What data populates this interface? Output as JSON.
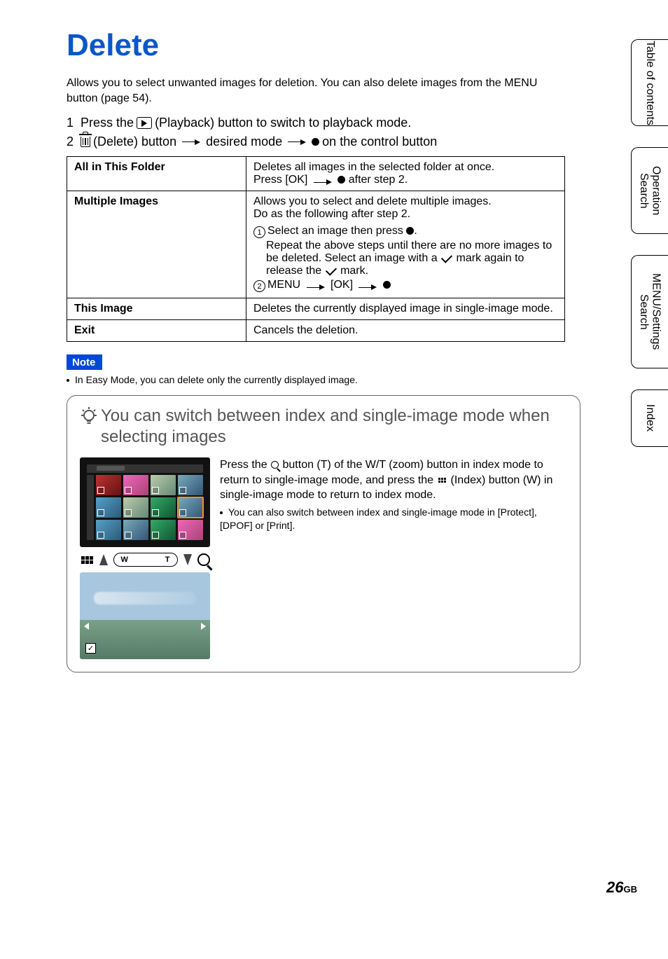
{
  "title": "Delete",
  "intro": "Allows you to select unwanted images for deletion. You can also delete images from the MENU button (page 54).",
  "step1": {
    "num": "1",
    "before": "Press the",
    "after": "(Playback) button to switch to playback mode."
  },
  "step2": {
    "num": "2",
    "a": "(Delete) button",
    "b": "desired mode",
    "c": "on the control button"
  },
  "table": {
    "r1": {
      "label": "All in This Folder",
      "line1": "Deletes all images in the selected folder at once.",
      "line2a": "Press [OK]",
      "line2b": "after step 2."
    },
    "r2": {
      "label": "Multiple Images",
      "line1": "Allows you to select and delete multiple images.",
      "line2": "Do as the following after step 2.",
      "s1a": "Select an image then press",
      "s1b": ".",
      "s1c": "Repeat the above steps until there are no more images to be deleted. Select an image with a",
      "s1d": "mark again to release the",
      "s1e": "mark.",
      "s2a": "MENU",
      "s2b": "[OK]"
    },
    "r3": {
      "label": "This Image",
      "desc": "Deletes the currently displayed image in single-image mode."
    },
    "r4": {
      "label": "Exit",
      "desc": "Cancels the deletion."
    }
  },
  "note": {
    "badge": "Note",
    "text": "In Easy Mode, you can delete only the currently displayed image."
  },
  "tip": {
    "title": "You can switch between index and single-image mode when selecting images",
    "body_a": "Press the",
    "body_b": "button (T) of the W/T (zoom) button in index mode to return to single-image mode, and press the",
    "body_c": "(Index) button (W) in single-image mode to return to index mode.",
    "sub": "You can also switch between index and single-image mode in [Protect], [DPOF] or [Print].",
    "zoom_w": "W",
    "zoom_t": "T"
  },
  "tabs": {
    "t1": "Table of contents",
    "t2": "Operation Search",
    "t3": "MENU/Settings Search",
    "t4": "Index"
  },
  "page_number": "26",
  "page_suffix": "GB"
}
